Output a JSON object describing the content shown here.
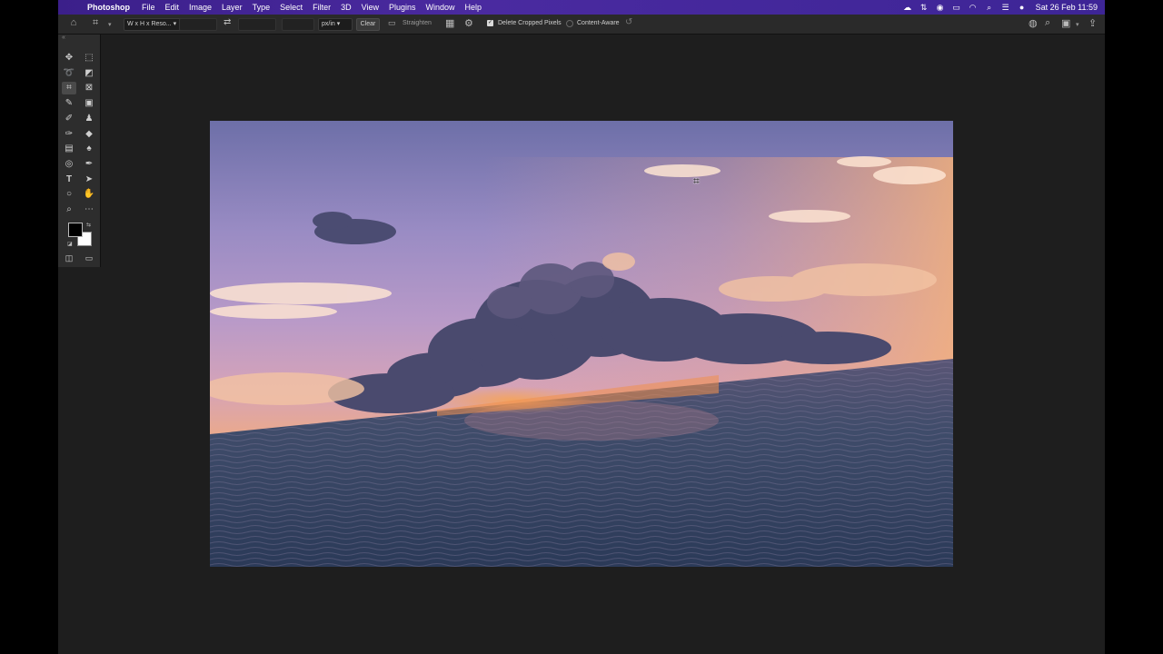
{
  "menubar": {
    "app_name": "Photoshop",
    "items": [
      "File",
      "Edit",
      "Image",
      "Layer",
      "Type",
      "Select",
      "Filter",
      "3D",
      "View",
      "Plugins",
      "Window",
      "Help"
    ],
    "clock": "Sat 26 Feb  11:59"
  },
  "options": {
    "ratio_preset": "W x H x Reso...",
    "units": "px/in",
    "clear_label": "Clear",
    "straighten_label": "Straighten",
    "delete_cropped_label": "Delete Cropped Pixels",
    "delete_cropped_checked": true,
    "content_aware_label": "Content-Aware",
    "content_aware_checked": false
  },
  "tools": {
    "active": "crop-tool",
    "foreground_color": "#000000",
    "background_color": "#ffffff"
  },
  "colors": {
    "menubar": "#3d2596",
    "workspace": "#1e1e1e",
    "panel": "#2d2d2d"
  }
}
